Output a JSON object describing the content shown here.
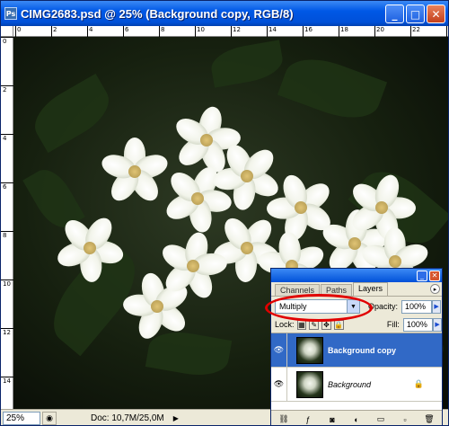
{
  "window": {
    "title": "CIMG2683.psd @ 25% (Background copy, RGB/8)",
    "icon": "ps-app-icon",
    "minimize": "_",
    "maximize": "□",
    "close": "✕"
  },
  "ruler": {
    "top": [
      "0",
      "2",
      "4",
      "6",
      "8",
      "10",
      "12",
      "14",
      "16",
      "18",
      "20",
      "22",
      "24"
    ],
    "left": [
      "0",
      "2",
      "4",
      "6",
      "8",
      "10",
      "12",
      "14"
    ]
  },
  "status": {
    "zoom": "25%",
    "doc": "Doc: 10,7M/25,0M"
  },
  "panel": {
    "tabs": [
      "Channels",
      "Paths",
      "Layers"
    ],
    "active_tab": "Layers",
    "blend_mode": "Multiply",
    "opacity_label": "Opacity:",
    "opacity_value": "100%",
    "lock_label": "Lock:",
    "fill_label": "Fill:",
    "fill_value": "100%",
    "layers": [
      {
        "name": "Background copy",
        "selected": true
      },
      {
        "name": "Background",
        "selected": false,
        "locked": true
      }
    ]
  }
}
